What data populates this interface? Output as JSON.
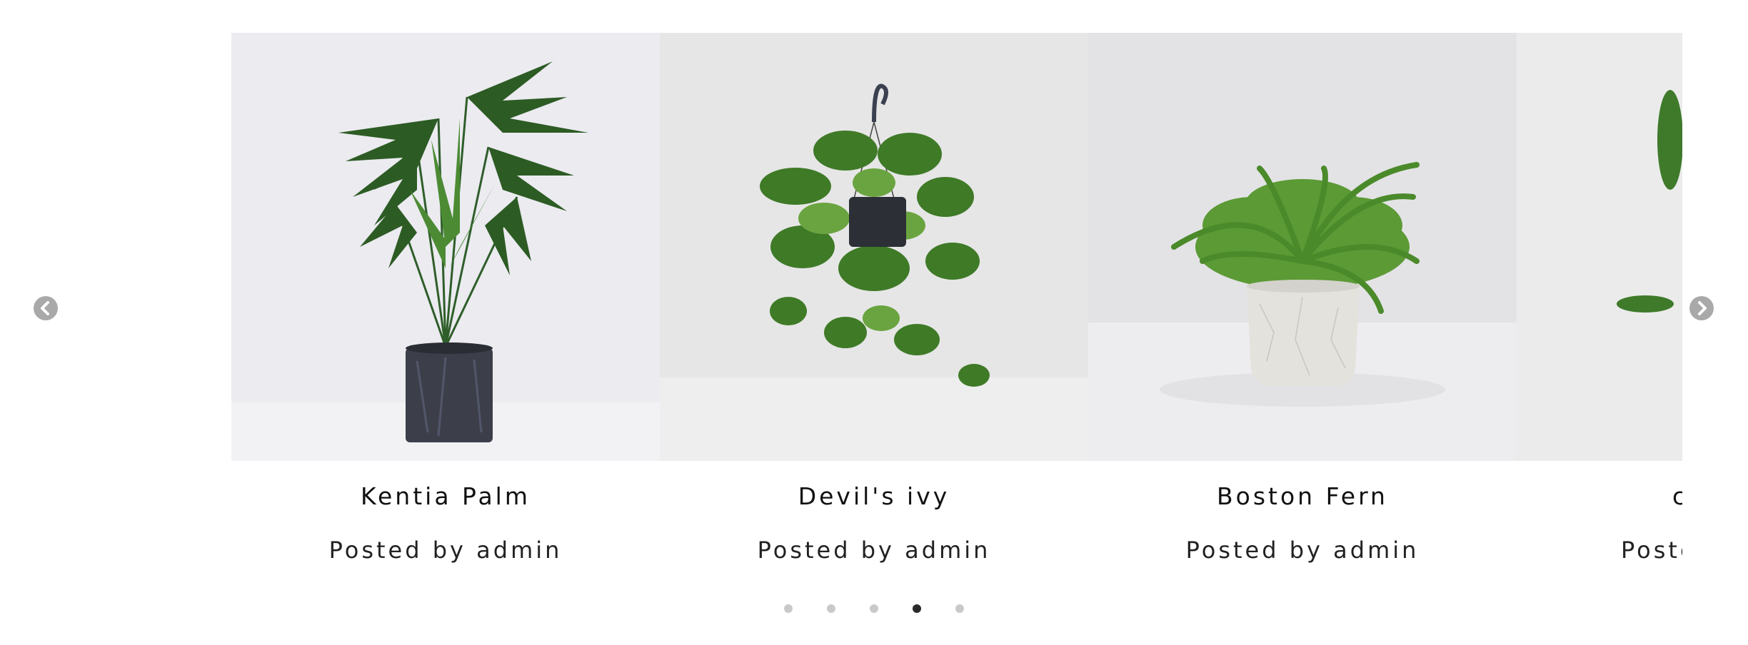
{
  "carousel": {
    "prev_icon": "chevron-left-circle-icon",
    "next_icon": "chevron-right-circle-icon",
    "posts": [
      {
        "title": "Kentia Palm",
        "meta": "Posted by admin",
        "image": "kentia-palm-photo"
      },
      {
        "title": "Devil's ivy",
        "meta": "Posted by admin",
        "image": "devils-ivy-photo"
      },
      {
        "title": "Boston Fern",
        "meta": "Posted by admin",
        "image": "boston-fern-photo"
      },
      {
        "title": "c",
        "meta": "Poste",
        "image": "partial-plant-photo"
      }
    ],
    "pagination": {
      "count": 5,
      "active_index": 3
    },
    "colors": {
      "arrow": "#a9a9a9",
      "dot_inactive": "#c9c9c9",
      "dot_active": "#2a2a2a",
      "title_text": "#111111"
    }
  }
}
